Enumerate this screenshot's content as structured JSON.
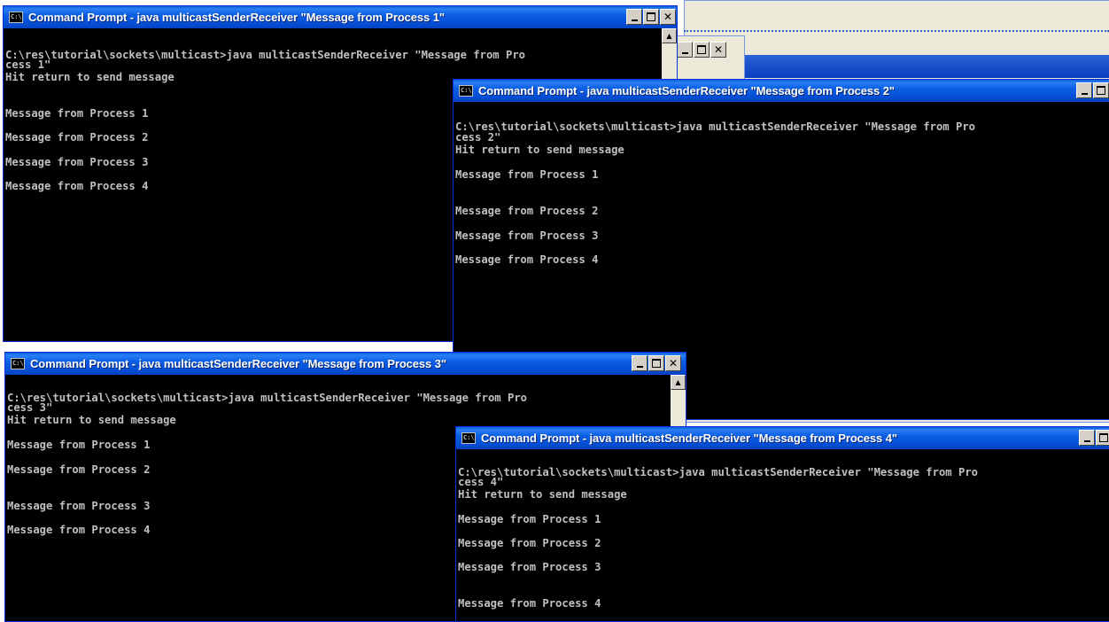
{
  "windows": [
    {
      "title": "Command Prompt - java multicastSenderReceiver \"Message from Process 1\"",
      "icon": "C:\\",
      "lines": [
        "C:\\res\\tutorial\\sockets\\multicast>java multicastSenderReceiver \"Message from Pro",
        "cess 1\"",
        "Hit return to send message",
        "Message from Process 1",
        "Message from Process 2",
        "Message from Process 3",
        "Message from Process 4"
      ]
    },
    {
      "title": "Command Prompt - java multicastSenderReceiver \"Message from Process 2\"",
      "icon": "C:\\",
      "lines": [
        "C:\\res\\tutorial\\sockets\\multicast>java multicastSenderReceiver \"Message from Pro",
        "cess 2\"",
        "Hit return to send message",
        "Message from Process 1",
        "Message from Process 2",
        "Message from Process 3",
        "Message from Process 4"
      ]
    },
    {
      "title": "Command Prompt - java multicastSenderReceiver \"Message from Process 3\"",
      "icon": "C:\\",
      "lines": [
        "C:\\res\\tutorial\\sockets\\multicast>java multicastSenderReceiver \"Message from Pro",
        "cess 3\"",
        "Hit return to send message",
        "Message from Process 1",
        "Message from Process 2",
        "Message from Process 3",
        "Message from Process 4"
      ]
    },
    {
      "title": "Command Prompt - java multicastSenderReceiver \"Message from Process 4\"",
      "icon": "C:\\",
      "lines": [
        "C:\\res\\tutorial\\sockets\\multicast>java multicastSenderReceiver \"Message from Pro",
        "cess 4\"",
        "Hit return to send message",
        "Message from Process 1",
        "Message from Process 2",
        "Message from Process 3",
        "Message from Process 4"
      ]
    }
  ],
  "colors": {
    "titlebar": "#0a5fdb",
    "console_bg": "#000000",
    "console_text": "#c0c0c0"
  }
}
